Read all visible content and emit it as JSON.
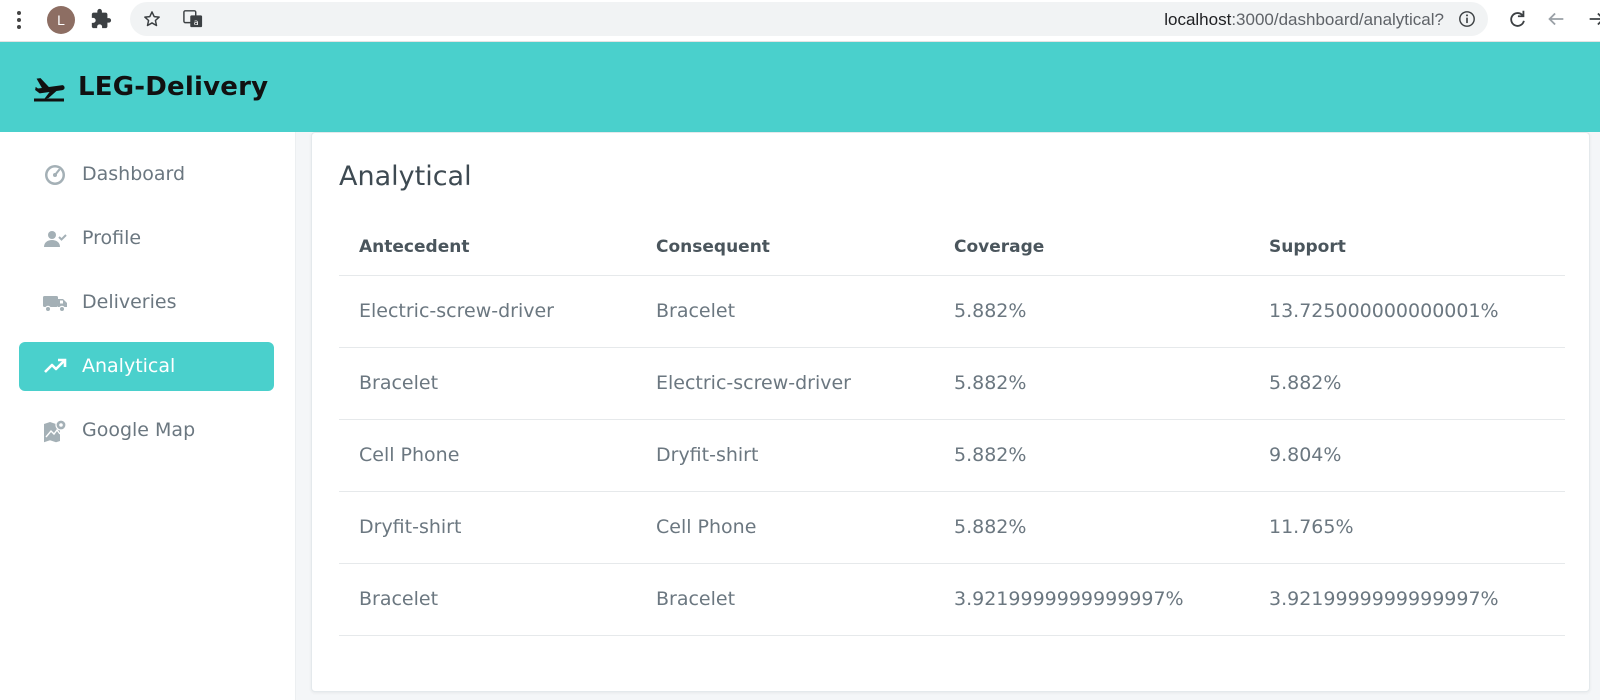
{
  "browser": {
    "avatar_letter": "L",
    "url_host": "localhost",
    "url_path": ":3000/dashboard/analytical?"
  },
  "app": {
    "brand": "LEG-Delivery",
    "accent_color": "#4ad0cc"
  },
  "sidebar": {
    "items": [
      {
        "label": "Dashboard",
        "icon": "speedometer-icon",
        "active": false
      },
      {
        "label": "Profile",
        "icon": "user-check-icon",
        "active": false
      },
      {
        "label": "Deliveries",
        "icon": "truck-icon",
        "active": false
      },
      {
        "label": "Analytical",
        "icon": "trending-up-icon",
        "active": true
      },
      {
        "label": "Google Map",
        "icon": "map-pin-icon",
        "active": false
      }
    ]
  },
  "main": {
    "title": "Analytical",
    "table": {
      "columns": [
        "Antecedent",
        "Consequent",
        "Coverage",
        "Support"
      ],
      "rows": [
        [
          "Electric-screw-driver",
          "Bracelet",
          "5.882%",
          "13.725000000000001%"
        ],
        [
          "Bracelet",
          "Electric-screw-driver",
          "5.882%",
          "5.882%"
        ],
        [
          "Cell Phone",
          "Dryfit-shirt",
          "5.882%",
          "9.804%"
        ],
        [
          "Dryfit-shirt",
          "Cell Phone",
          "5.882%",
          "11.765%"
        ],
        [
          "Bracelet",
          "Bracelet",
          "3.9219999999999997%",
          "3.9219999999999997%"
        ]
      ]
    }
  }
}
